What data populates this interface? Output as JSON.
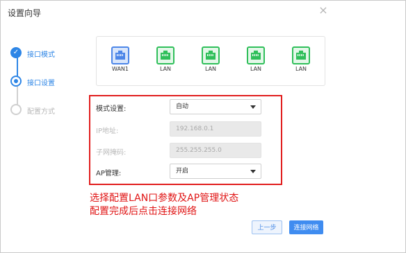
{
  "dialog": {
    "title": "设置向导",
    "close_glyph": "×"
  },
  "steps": [
    {
      "label": "接口模式",
      "state": "done"
    },
    {
      "label": "接口设置",
      "state": "active"
    },
    {
      "label": "配置方式",
      "state": "todo"
    }
  ],
  "ports": [
    {
      "label": "WAN1",
      "type": "wan",
      "icon": "ethernet-port-icon"
    },
    {
      "label": "LAN",
      "type": "lan",
      "icon": "ethernet-port-icon"
    },
    {
      "label": "LAN",
      "type": "lan",
      "icon": "ethernet-port-icon"
    },
    {
      "label": "LAN",
      "type": "lan",
      "icon": "ethernet-port-icon"
    },
    {
      "label": "LAN",
      "type": "lan",
      "icon": "ethernet-port-icon"
    }
  ],
  "form": {
    "mode": {
      "label": "模式设置:",
      "value": "自动"
    },
    "ip": {
      "label": "IP地址:",
      "value": "192.168.0.1"
    },
    "mask": {
      "label": "子网掩码:",
      "value": "255.255.255.0"
    },
    "ap": {
      "label": "AP管理:",
      "value": "开启"
    }
  },
  "annotation": {
    "line1": "选择配置LAN口参数及AP管理状态",
    "line2": "配置完成后点击连接网络"
  },
  "buttons": {
    "prev": "上一步",
    "next": "连接网络"
  },
  "colors": {
    "accent": "#2e86e6",
    "wan": "#4c86e8",
    "lan": "#2fbf5a",
    "highlight": "#e11c1c"
  }
}
